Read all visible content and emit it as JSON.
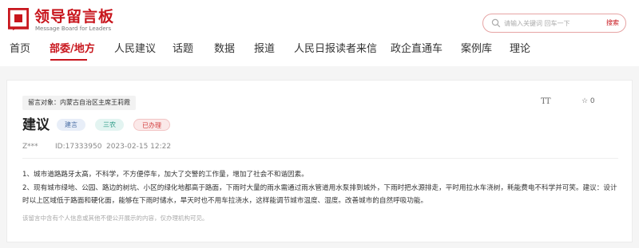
{
  "header": {
    "logo_title": "领导留言板",
    "logo_subtitle": "Message Board for Leaders",
    "brand_color": "#c8161d",
    "search": {
      "placeholder": "请输入关键词 回车一下",
      "button_label": "搜索"
    }
  },
  "nav": {
    "items": [
      {
        "label": "首页"
      },
      {
        "label": "部委/地方",
        "active": true
      },
      {
        "label": "人民建议"
      },
      {
        "label": "话题"
      },
      {
        "label": "数据"
      },
      {
        "label": "报道"
      },
      {
        "label": "人民日报读者来信"
      },
      {
        "label": "政企直通车"
      },
      {
        "label": "案例库"
      },
      {
        "label": "理论"
      }
    ]
  },
  "message": {
    "target": "留言对象：内蒙古自治区主席王莉霞",
    "title": "建议",
    "badges": {
      "type": "建言",
      "field": "三农",
      "status": "已办理"
    },
    "user": "Z***",
    "id": "ID:17333950",
    "time": "2023-02-15 12:22",
    "font_size_icon": "TT",
    "star": "☆ 0",
    "paragraphs": [
      "1、城市道路路牙太高，不科学，不方便停车，加大了交警的工作量，增加了社会不和谐因素。",
      "2、现有城市绿地、公园、路边的树坑、小区的绿化地都高于路面，下雨时大量的雨水需通过雨水管道用水泵排到城外，下雨时把水源排走，平时用拉水车浇树，耗能费电不科学并可笑。建议：设计时以上区域低于路面和硬化面，能够在下雨时储水，旱天时也不用车拉浇水，这样能调节城市温度、湿度。改善城市的自然呼吸功能。"
    ],
    "disclaimer": "该留言中含有个人信息或其他不便公开展示的内容，仅办理机构可见。"
  }
}
